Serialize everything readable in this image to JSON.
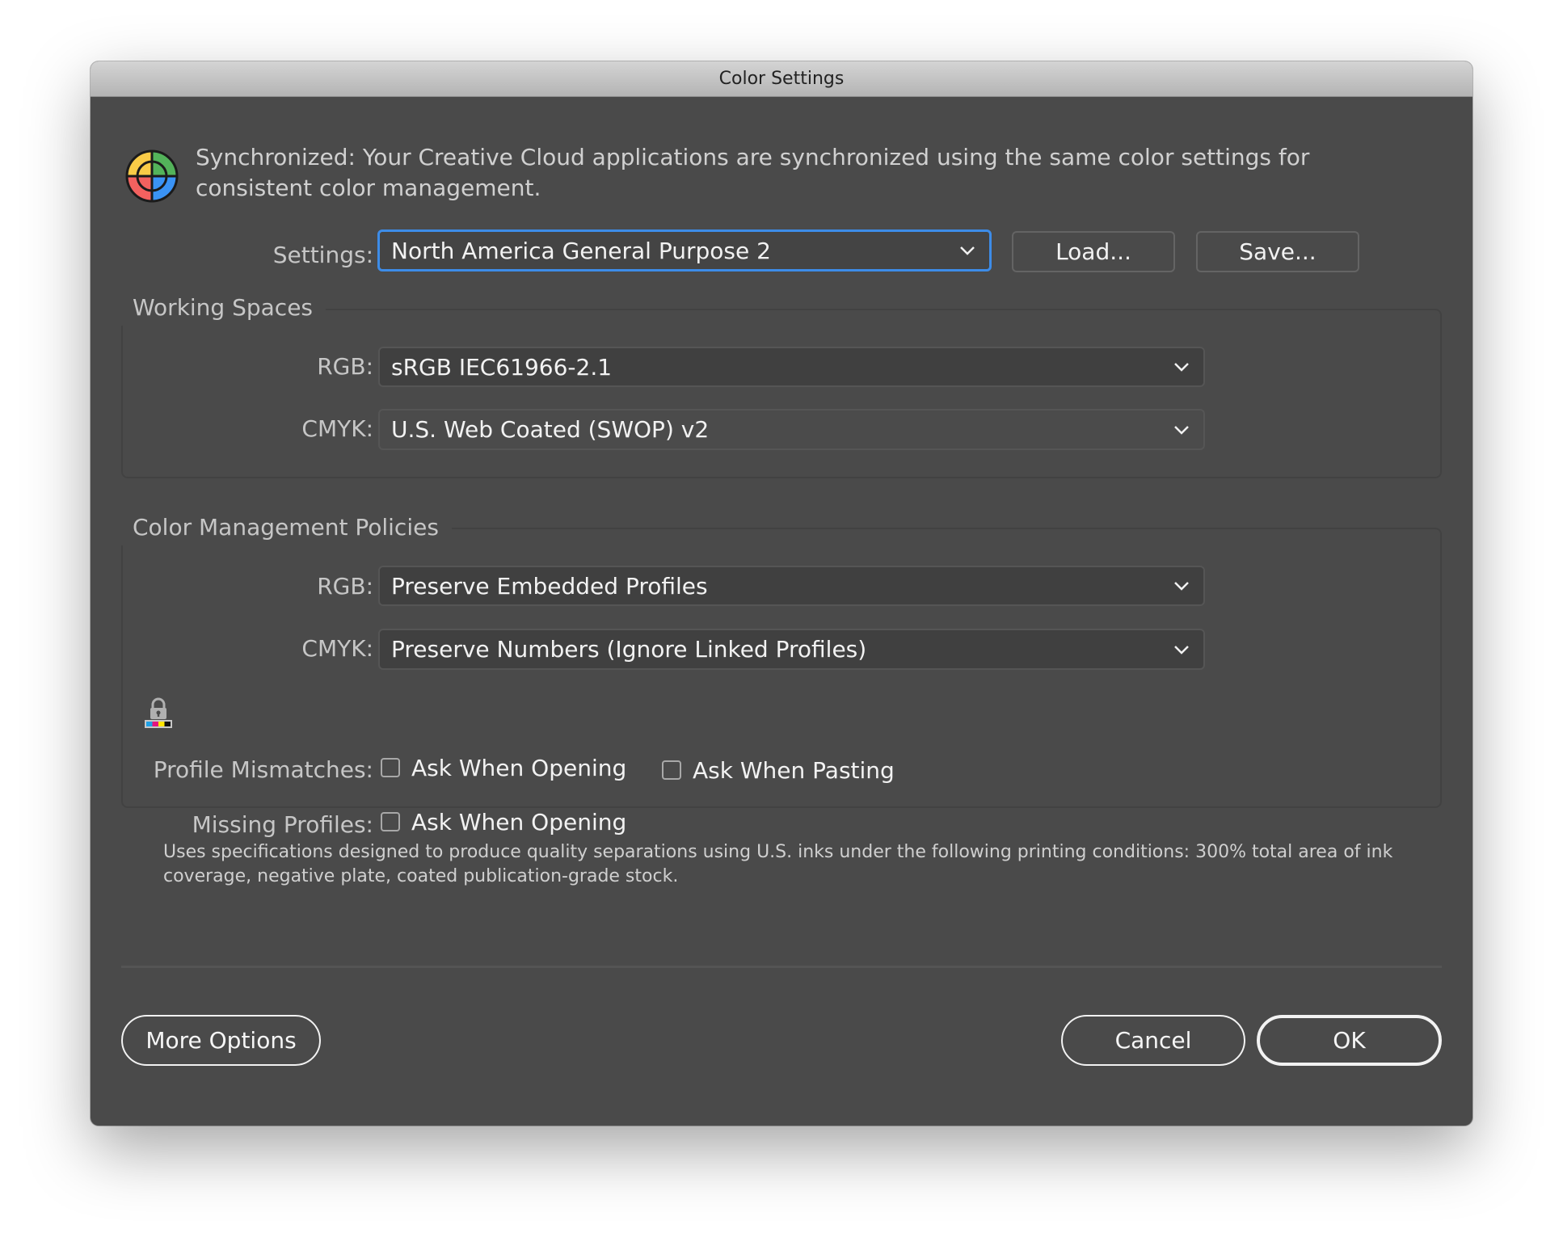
{
  "window": {
    "title": "Color Settings"
  },
  "sync": {
    "icon": "color-sync-icon",
    "message": "Synchronized: Your Creative Cloud applications are synchronized using the same color settings for consistent color management."
  },
  "settings": {
    "label": "Settings:",
    "value": "North America General Purpose 2",
    "load_label": "Load...",
    "save_label": "Save..."
  },
  "working_spaces": {
    "title": "Working Spaces",
    "rgb_label": "RGB:",
    "rgb_value": "sRGB IEC61966-2.1",
    "cmyk_label": "CMYK:",
    "cmyk_value": "U.S. Web Coated (SWOP) v2"
  },
  "policies": {
    "title": "Color Management Policies",
    "rgb_label": "RGB:",
    "rgb_value": "Preserve Embedded Profiles",
    "cmyk_label": "CMYK:",
    "cmyk_value": "Preserve Numbers (Ignore Linked Profiles)",
    "lock_icon": "cmyk-lock-icon",
    "profile_mismatches_label": "Profile Mismatches:",
    "mismatch_opening_label": "Ask When Opening",
    "mismatch_opening_checked": false,
    "mismatch_pasting_label": "Ask When Pasting",
    "mismatch_pasting_checked": false,
    "missing_profiles_label": "Missing Profiles:",
    "missing_opening_label": "Ask When Opening",
    "missing_opening_checked": false
  },
  "description": "Uses specifications designed to produce quality separations using U.S. inks under the following printing conditions: 300% total area of ink coverage, negative plate, coated publication-grade stock.",
  "footer": {
    "more_options_label": "More Options",
    "cancel_label": "Cancel",
    "ok_label": "OK"
  },
  "colors": {
    "dialog_bg": "#4a4a4a",
    "focus_ring": "#3d8ce8",
    "icon_yellow": "#f9cb47",
    "icon_green": "#53b35a",
    "icon_red": "#f3615f",
    "icon_blue": "#3a93f5"
  }
}
